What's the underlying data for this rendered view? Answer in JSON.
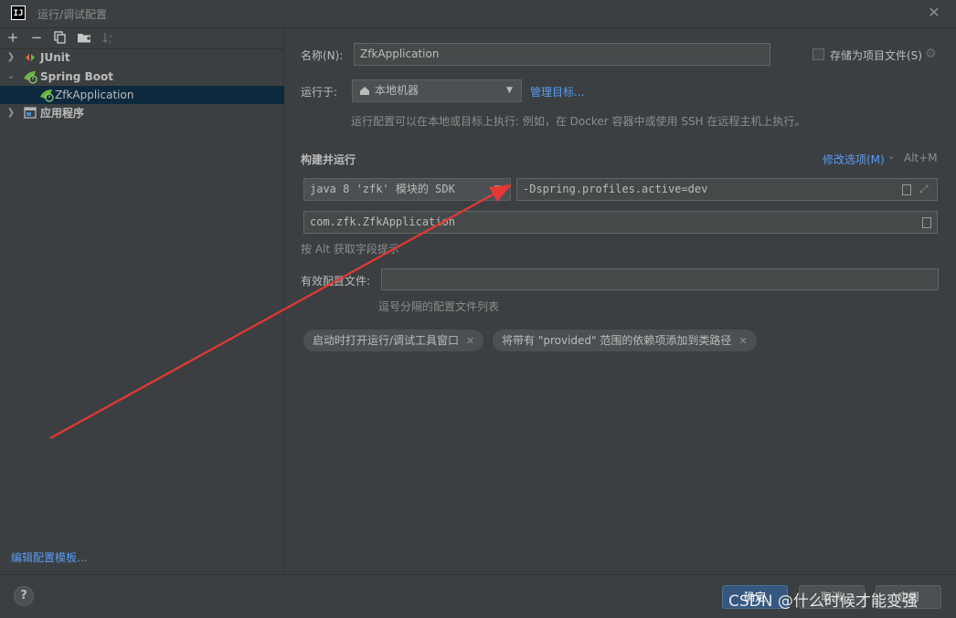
{
  "window": {
    "title": "运行/调试配置",
    "app_logo": "IJ"
  },
  "toolbar": {
    "icons": [
      "plus-icon",
      "minus-icon",
      "copy-icon",
      "folder-icon",
      "sort-icon"
    ]
  },
  "tree": {
    "items": [
      {
        "label": "JUnit",
        "expanded": false
      },
      {
        "label": "Spring Boot",
        "expanded": true
      },
      {
        "label": "ZfkApplication",
        "selected": true
      },
      {
        "label": "应用程序",
        "expanded": false
      }
    ]
  },
  "left_footer": {
    "edit_templates": "编辑配置模板..."
  },
  "form": {
    "name_label": "名称(N):",
    "name_value": "ZfkApplication",
    "store_as_file_label": "存储为项目文件(S)",
    "run_on_label": "运行于:",
    "run_on_value": "本地机器",
    "manage_targets": "管理目标...",
    "run_on_hint": "运行配置可以在本地或目标上执行: 例如，在 Docker 容器中或使用 SSH 在远程主机上执行。",
    "build_run_header": "构建并运行",
    "modify_options": "修改选项(M)",
    "modify_options_shortcut": "Alt+M",
    "sdk_value": "java 8 'zfk' 模块的 SDK",
    "vm_options_value": "-Dspring.profiles.active=dev",
    "main_class_value": "com.zfk.ZfkApplication",
    "alt_hint": "按 Alt 获取字段提示",
    "active_profiles_label": "有效配置文件:",
    "active_profiles_value": "",
    "active_profiles_hint": "逗号分隔的配置文件列表",
    "tags": [
      "启动时打开运行/调试工具窗口",
      "将带有 \"provided\" 范围的依赖项添加到类路径"
    ]
  },
  "footer": {
    "help": "?",
    "ok": "确定",
    "cancel": "取消",
    "apply": "应用"
  },
  "watermark": "CSDN @什么时候才能变强",
  "colors": {
    "background": "#3c3f41",
    "selection": "#0d293e",
    "link": "#589df6",
    "annotation_arrow": "#e53935"
  }
}
